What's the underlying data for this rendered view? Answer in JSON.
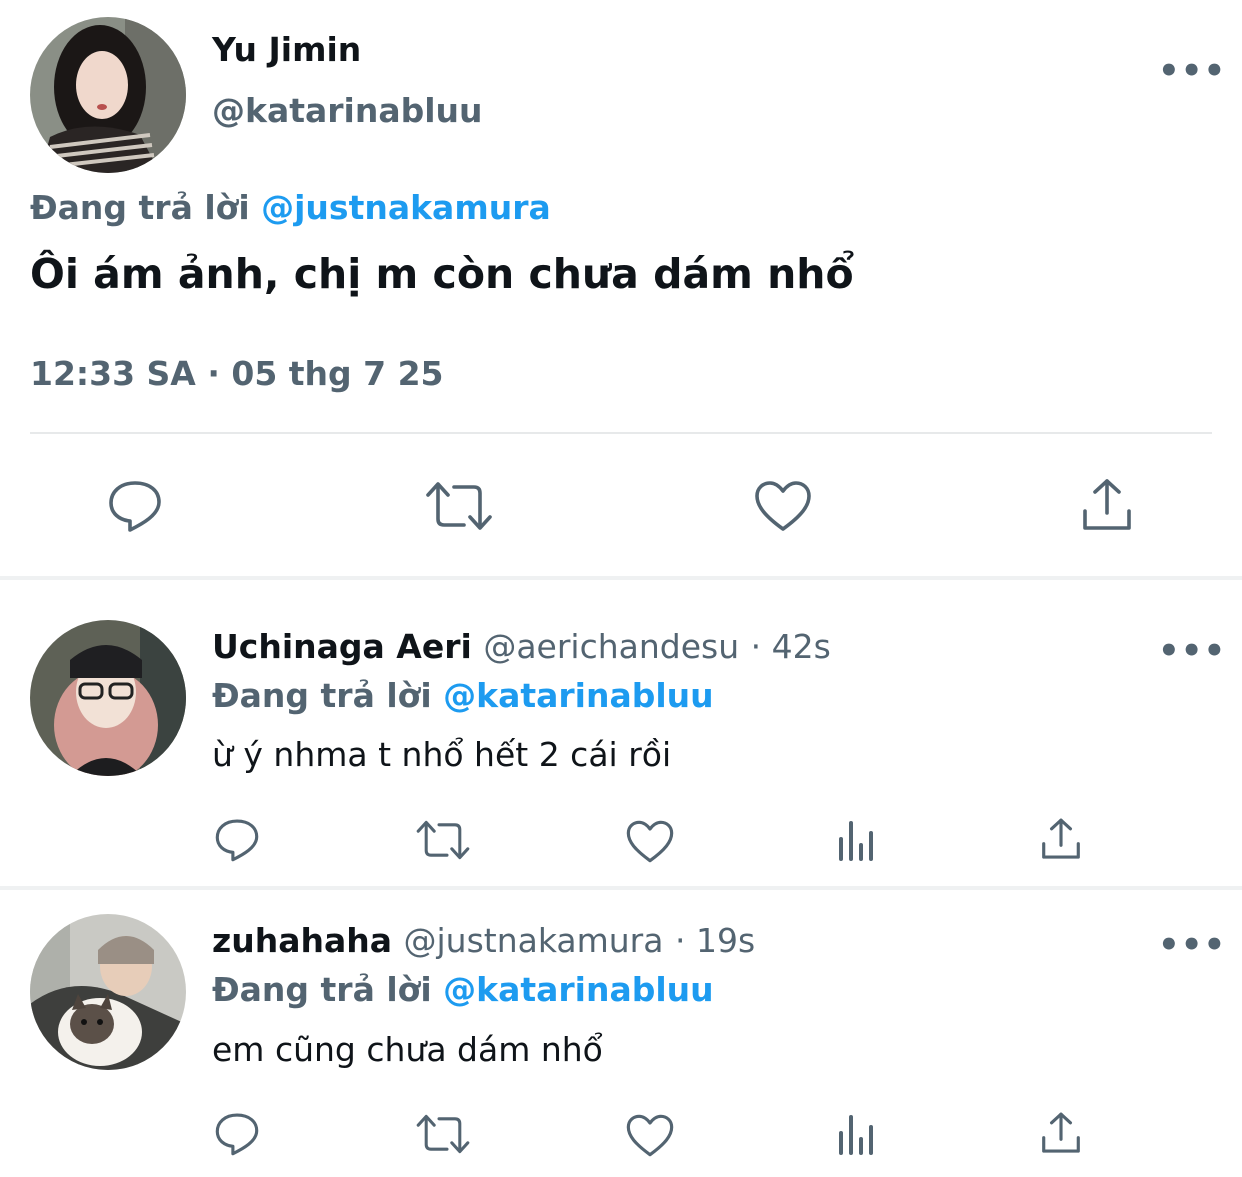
{
  "main_tweet": {
    "name": "Yu Jimin",
    "handle": "@katarinabluu",
    "more": "•••",
    "replying_prefix": "Đang trả lời",
    "replying_to": "@justnakamura",
    "text": "Ôi ám ảnh, chị m còn chưa dám nhổ",
    "timestamp": "12:33 SA · 05 thg 7 25",
    "actions": [
      "reply-icon",
      "retweet-icon",
      "like-icon",
      "share-icon"
    ]
  },
  "replies": [
    {
      "name": "Uchinaga Aeri",
      "handle": "@aerichandesu",
      "age": "· 42s",
      "replying_prefix": "Đang trả lời",
      "replying_to": "@katarinabluu",
      "text": "ừ ý nhma t nhổ hết 2 cái rồi",
      "more": "•••",
      "actions": [
        "reply-icon",
        "retweet-icon",
        "like-icon",
        "views-icon",
        "share-icon"
      ]
    },
    {
      "name": "zuhahaha",
      "handle": "@justnakamura",
      "age": "· 19s",
      "replying_prefix": "Đang trả lời",
      "replying_to": "@katarinabluu",
      "text": "em cũng chưa dám nhổ",
      "more": "•••",
      "actions": [
        "reply-icon",
        "retweet-icon",
        "like-icon",
        "views-icon",
        "share-icon"
      ]
    }
  ],
  "colors": {
    "text_primary": "#0f1419",
    "text_secondary": "#536471",
    "accent": "#1d9bf0",
    "divider": "#e7e9ea"
  }
}
